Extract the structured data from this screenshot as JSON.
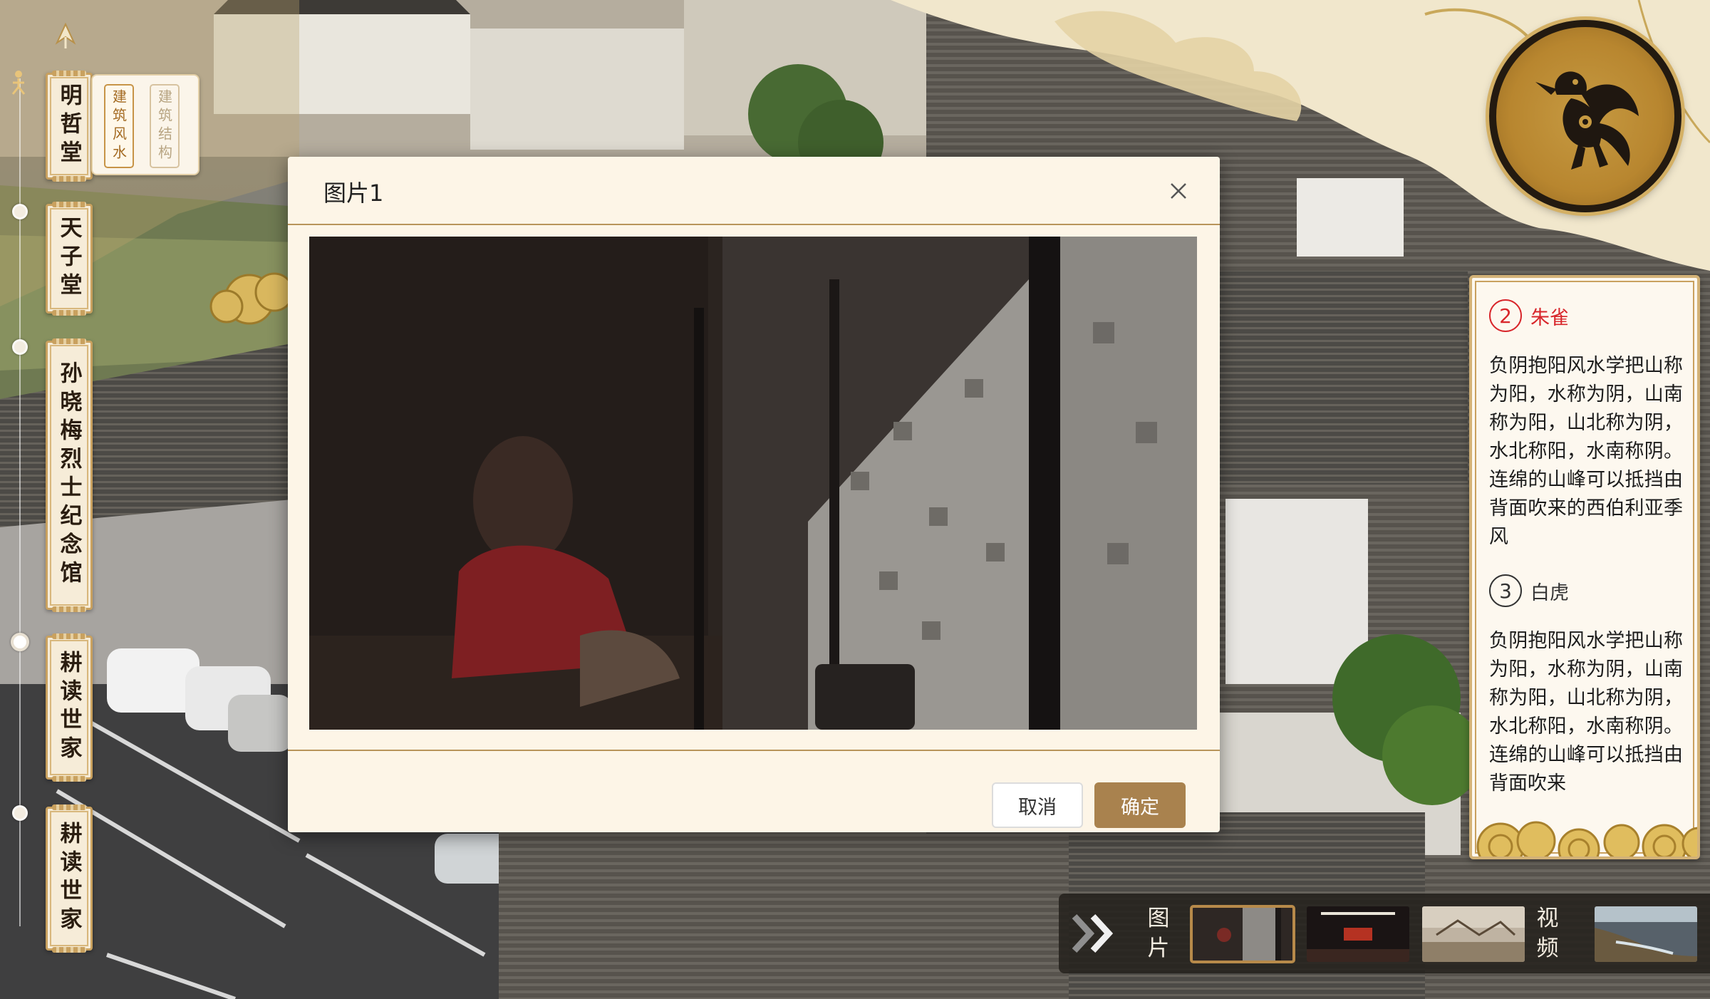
{
  "sidebar": {
    "items": [
      {
        "label": "明哲堂",
        "active": true
      },
      {
        "label": "天子堂",
        "active": false
      },
      {
        "label": "孙晓梅烈士纪念馆",
        "active": false
      },
      {
        "label": "耕读世家",
        "active": false
      },
      {
        "label": "耕读世家",
        "active": false
      }
    ],
    "subnav": [
      {
        "label": "建筑风水",
        "active": true
      },
      {
        "label": "建筑结构",
        "active": false
      }
    ]
  },
  "info_panel": {
    "sections": [
      {
        "number": "2",
        "title": "朱雀",
        "active": true,
        "text": "负阴抱阳风水学把山称为阳，水称为阴，山南称为阳，山北称为阴，水北称阳，水南称阴。连绵的山峰可以抵挡由背面吹来的西伯利亚季风"
      },
      {
        "number": "3",
        "title": "白虎",
        "active": false,
        "text": "负阴抱阳风水学把山称为阳，水称为阴，山南称为阳，山北称为阴，水北称阳，水南称阴。连绵的山峰可以抵挡由背面吹来"
      }
    ]
  },
  "media_strip": {
    "images_label": "图片",
    "videos_label": "视频",
    "thumbnails": [
      {
        "kind": "image",
        "active": true
      },
      {
        "kind": "image",
        "active": false
      },
      {
        "kind": "image",
        "active": false
      },
      {
        "kind": "video",
        "active": false
      }
    ]
  },
  "modal": {
    "title": "图片1",
    "cancel_label": "取消",
    "confirm_label": "确定"
  },
  "icons": {
    "home": "home-arrow-icon",
    "location": "person-marker-icon",
    "close": "close-icon",
    "expand": "double-chevron-right-icon",
    "badge": "phoenix-emblem-icon"
  },
  "colors": {
    "accent_gold": "#a9824e",
    "highlight_red": "#d8262b",
    "panel_bg": "#fdf5e7"
  }
}
